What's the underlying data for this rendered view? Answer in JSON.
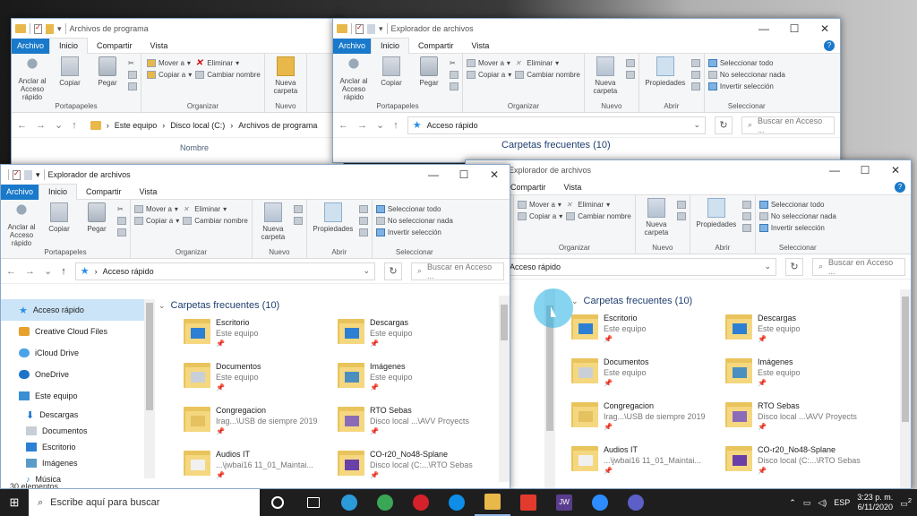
{
  "screen": {
    "desktop_bg": "#2a2a2a"
  },
  "common": {
    "tab_file": "Archivo",
    "tab_home": "Inicio",
    "tab_share": "Compartir",
    "tab_view": "Vista",
    "pin_label": "Anclar al Acceso rápido",
    "copy_label": "Copiar",
    "paste_label": "Pegar",
    "move_to": "Mover a",
    "copy_to": "Copiar a",
    "delete": "Eliminar",
    "rename": "Cambiar nombre",
    "new_folder": "Nueva carpeta",
    "properties": "Propiedades",
    "select_all": "Seleccionar todo",
    "select_none": "No seleccionar nada",
    "invert_selection": "Invertir selección",
    "grp_clipboard": "Portapapeles",
    "grp_organize": "Organizar",
    "grp_new": "Nuevo",
    "grp_open": "Abrir",
    "grp_select": "Seleccionar",
    "search_placeholder": "Buscar en Acceso ...",
    "quick_access": "Acceso rápido"
  },
  "win_back_left": {
    "title": "Archivos de programa",
    "path_1": "Este equipo",
    "path_2": "Disco local (C:)",
    "path_3": "Archivos de programa",
    "column_name": "Nombre",
    "nav_partial": "Acceso rápido"
  },
  "win_back_right": {
    "title": "Explorador de archivos",
    "section_partial": "Carpetas frecuentes (10)"
  },
  "win_front_left": {
    "title": "Explorador de archivos",
    "nav": [
      {
        "label": "Acceso rápido"
      },
      {
        "label": "Creative Cloud Files"
      },
      {
        "label": "iCloud Drive"
      },
      {
        "label": "OneDrive"
      },
      {
        "label": "Este equipo"
      },
      {
        "label": "Descargas"
      },
      {
        "label": "Documentos"
      },
      {
        "label": "Escritorio"
      },
      {
        "label": "Imágenes"
      },
      {
        "label": "Música"
      }
    ],
    "status": "30 elementos"
  },
  "win_front_right": {
    "title": "Explorador de archivos"
  },
  "frequent": {
    "heading": "Carpetas frecuentes (10)",
    "items": [
      {
        "name": "Escritorio",
        "loc": "Este equipo",
        "color": "#2d7fd3"
      },
      {
        "name": "Descargas",
        "loc": "Este equipo",
        "color": "#2d7fd3"
      },
      {
        "name": "Documentos",
        "loc": "Este equipo",
        "color": "#c9cfd8"
      },
      {
        "name": "Imágenes",
        "loc": "Este equipo",
        "color": "#4a8fbf"
      },
      {
        "name": "Congregacion",
        "loc": "Irag...\\USB de siempre 2019",
        "color": "#e6c160"
      },
      {
        "name": "RTO Sebas",
        "loc": "Disco local ...\\AVV Proyects",
        "color": "#8b6bb8"
      },
      {
        "name": "Audios IT",
        "loc": "...\\jwbai16 11_01_Maintai...",
        "color": "#f0f0f0"
      },
      {
        "name": "CO-r20_No48-Splane",
        "loc": "Disco local (C:...\\RTO Sebas",
        "color": "#6b3fa8"
      }
    ],
    "items_right_partial": [
      {
        "name": "Audios IT",
        "loc": "...\\jwbai16 11_01_Maintai..."
      },
      {
        "name": "CO-r20_No48-Splane",
        "loc": "Disco local (C:...\\RTO Sebas"
      }
    ]
  },
  "taskbar": {
    "search_placeholder": "Escribe aquí para buscar",
    "lang": "ESP",
    "time": "3:23 p. m.",
    "date": "6/11/2020",
    "notif_count": "2",
    "apps": [
      {
        "name": "cortana",
        "color": "#ffffff"
      },
      {
        "name": "task-view",
        "color": "#ffffff"
      },
      {
        "name": "edge",
        "color": "#2b9ad8"
      },
      {
        "name": "chrome",
        "color": "#3aa757"
      },
      {
        "name": "opera",
        "color": "#d4212b"
      },
      {
        "name": "teamviewer",
        "color": "#0e8ee9"
      },
      {
        "name": "file-explorer",
        "color": "#e8b84a"
      },
      {
        "name": "camtasia",
        "color": "#e23b2e"
      },
      {
        "name": "jw-library",
        "color": "#5a3d8e"
      },
      {
        "name": "zoom",
        "color": "#2d8cff"
      },
      {
        "name": "teams",
        "color": "#5b5fc7"
      }
    ],
    "jw_label": "JW"
  }
}
